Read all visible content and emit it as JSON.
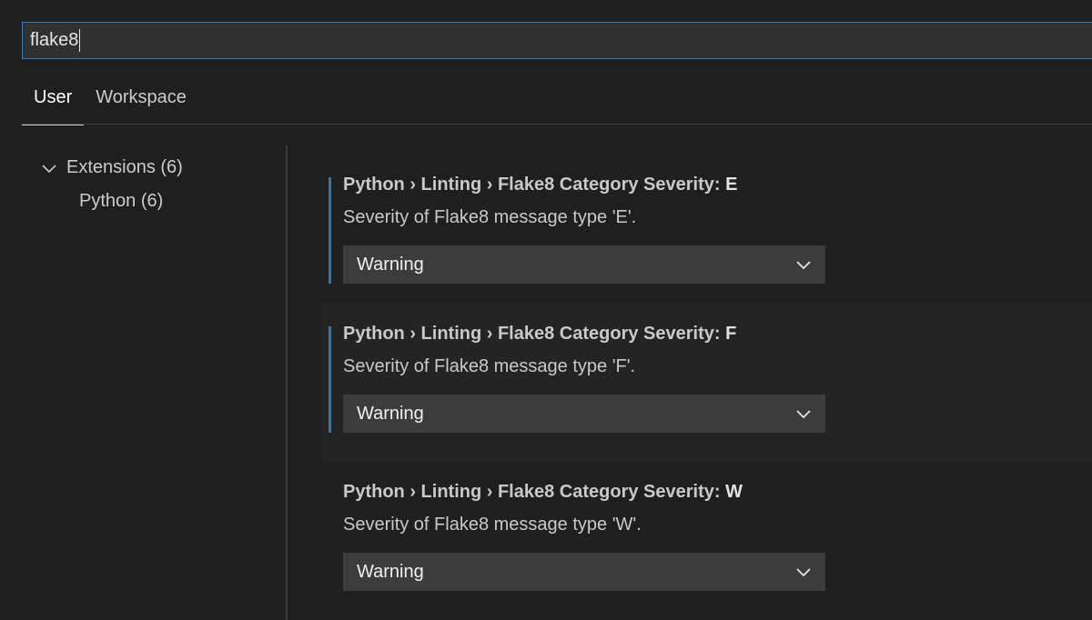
{
  "search": {
    "value": "flake8"
  },
  "tabs": [
    {
      "label": "User"
    },
    {
      "label": "Workspace"
    }
  ],
  "tree": {
    "group": {
      "label": "Extensions (6)"
    },
    "child": {
      "label": "Python (6)"
    }
  },
  "settings": [
    {
      "path": "Python › Linting › Flake8 Category Severity: ",
      "key": "E",
      "description": "Severity of Flake8 message type 'E'.",
      "value": "Warning"
    },
    {
      "path": "Python › Linting › Flake8 Category Severity: ",
      "key": "F",
      "description": "Severity of Flake8 message type 'F'.",
      "value": "Warning"
    },
    {
      "path": "Python › Linting › Flake8 Category Severity: ",
      "key": "W",
      "description": "Severity of Flake8 message type 'W'.",
      "value": "Warning"
    }
  ],
  "icons": {
    "tree_toggle": "chevron-down-icon",
    "dropdown": "chevron-down-icon"
  },
  "colors": {
    "background": "#1f1f1f",
    "focus_border": "#2f7ec1",
    "modified_indicator": "#2b79b3",
    "dropdown_background": "#3c3c3c"
  }
}
